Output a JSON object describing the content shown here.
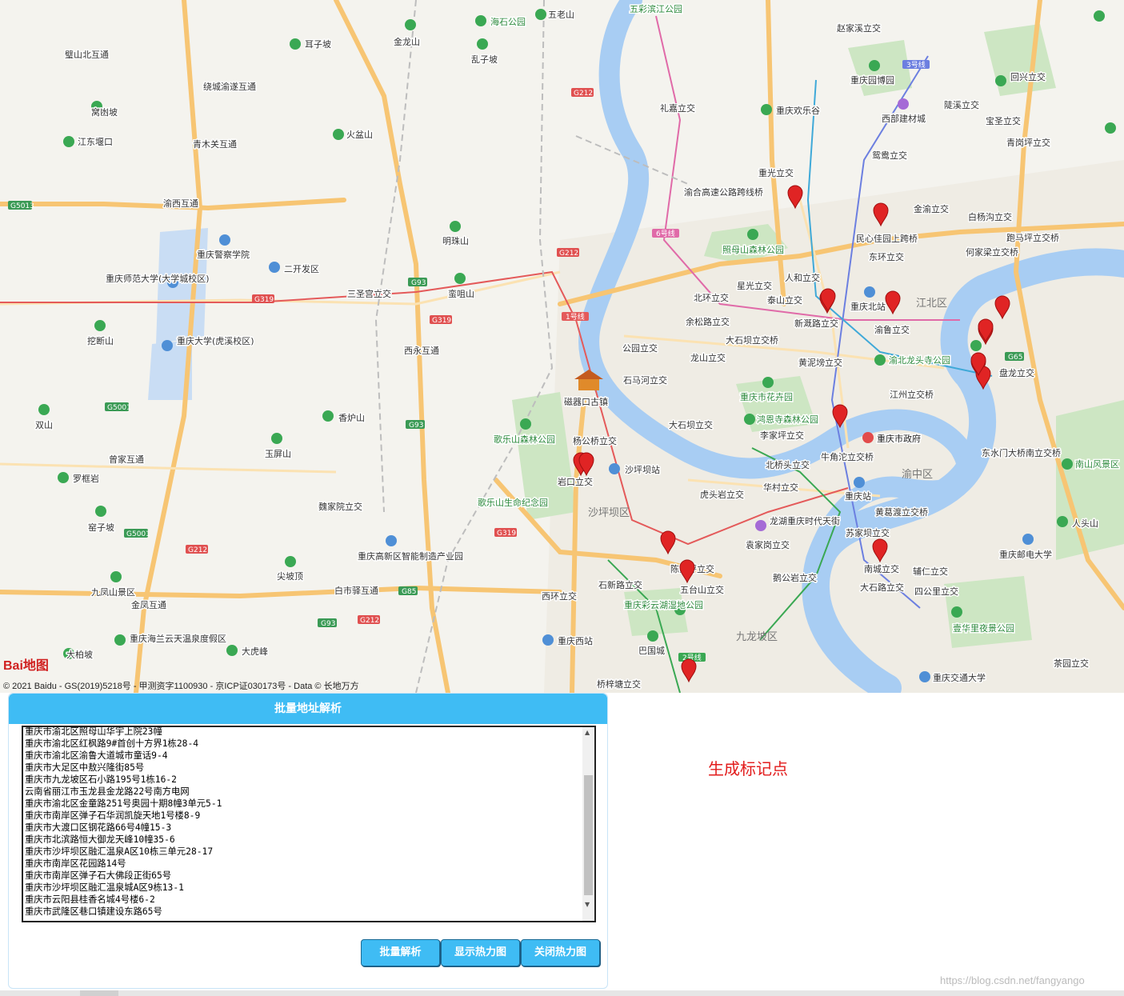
{
  "map": {
    "logo_text": "Bai地图",
    "copyright": "© 2021 Baidu - GS(2019)5218号 - 甲测资字1100930 - 京ICP证030173号 - Data © 长地万方",
    "district_labels": [
      "江北区",
      "沙坪坝区",
      "九龙坡区",
      "渝中区"
    ],
    "place_labels": [
      "璧山北互通",
      "绕城渝遂互通",
      "窝凼坡",
      "江东堰口",
      "青木关互通",
      "渝西互通",
      "重庆警察学院",
      "二开发区",
      "重庆师范大学(大学城校区)",
      "三圣宫立交",
      "重庆大学(虎溪校区)",
      "西永互通",
      "明珠山",
      "香炉山",
      "玉屏山",
      "曾家互通",
      "罗框岩",
      "窑子坡",
      "魏家院立交",
      "重庆高新区智能制造产业园",
      "白市驿互通",
      "九凤山景区",
      "金凤互通",
      "重庆海兰云天温泉度假区",
      "大柏坡",
      "大虎峰",
      "西环立交",
      "重庆西站",
      "巴国城",
      "桥梓塘立交",
      "礼嘉立交",
      "重庆欢乐谷",
      "重庆园博园",
      "西部建材城",
      "赵家溪立交",
      "陡溪立交",
      "宝圣立交",
      "回兴立交",
      "鸳鸯立交",
      "青岗坪立交",
      "重光立交",
      "渝合高速公路跨线桥",
      "照母山森林公园",
      "金渝立交",
      "民心佳园上跨桥",
      "白杨沟立交",
      "跑马坪立交桥",
      "何家梁立交桥",
      "东环立交",
      "人和立交",
      "星光立交",
      "北环立交",
      "泰山立交",
      "新溉路立交",
      "重庆北站",
      "渝鲁立交",
      "余松路立交",
      "大石坝立交桥",
      "公园立交",
      "龙山立交",
      "黄泥塝立交",
      "渝北龙头寺公园",
      "盘龙立交",
      "石马河立交",
      "磁器口古镇",
      "重庆市花卉园",
      "江州立交桥",
      "大石坝立交",
      "鸿恩寺森林公园",
      "李家坪立交",
      "重庆市政府",
      "杨公桥立交",
      "沙坪坝站",
      "岩口立交",
      "歌乐山森林公园",
      "北桥头立交",
      "牛角沱立交桥",
      "东水门大桥南立交桥",
      "歌乐山生命纪念园",
      "虎头岩立交",
      "华村立交",
      "重庆站",
      "黄葛渡立交桥",
      "南山风景区",
      "人头山",
      "龙湖重庆时代天街",
      "袁家岗立交",
      "苏家坝立交",
      "重庆邮电大学",
      "陈家坪立交",
      "五台山立交",
      "石新路立交",
      "鹅公岩立交",
      "南城立交",
      "辅仁立交",
      "大石路立交",
      "四公里立交",
      "重庆彩云湖湿地公园",
      "壹华里夜景公园",
      "茶园立交",
      "重庆交通大学",
      "海石公园",
      "五老山",
      "乱子坡",
      "金龙山",
      "火盆山",
      "耳子坡",
      "蛮咀山",
      "挖断山",
      "双山",
      "五彩滨江公园",
      "尖坡顶"
    ],
    "markers_count": 18
  },
  "panel": {
    "title": "批量地址解析",
    "addresses": [
      "重庆市渝北区照母山华宇上院23幢",
      "重庆市渝北区红枫路9#首创十方界1栋28-4",
      "重庆市渝北区渝鲁大道城市童话9-4",
      "重庆市大足区中敖兴隆街85号",
      "重庆市九龙坡区石小路195号1栋16-2",
      "云南省丽江市玉龙县金龙路22号南方电网",
      "重庆市渝北区金童路251号奥园十期8幢3单元5-1",
      "重庆市南岸区弹子石华润凯旋天地1号楼8-9",
      "重庆市大渡口区钢花路66号4幢15-3",
      "重庆市北滨路恒大御龙天峰10幢35-6",
      "重庆市沙坪坝区融汇温泉A区10栋三单元28-17",
      "重庆市南岸区花园路14号",
      "重庆市南岸区弹子石大佛段正街65号",
      "重庆市沙坪坝区融汇温泉城A区9栋13-1",
      "重庆市云阳县桂香名城4号楼6-2",
      "重庆市武隆区巷口镇建设东路65号"
    ],
    "buttons": {
      "parse": "批量解析",
      "show_heat": "显示热力图",
      "hide_heat": "关闭热力图"
    }
  },
  "status_text": "生成标记点",
  "watermark": "https://blog.csdn.net/fangyango",
  "colors": {
    "accent": "#3fbcf4",
    "status": "#e21b1b",
    "marker": "#e02424",
    "river": "#5fa5e8"
  }
}
